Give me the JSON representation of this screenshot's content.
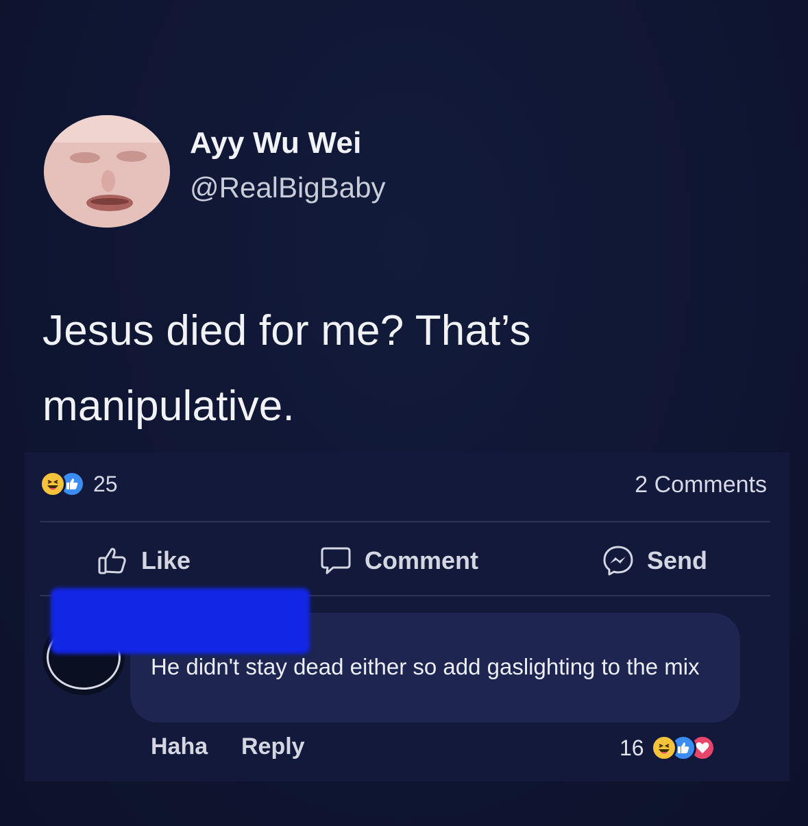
{
  "post": {
    "display_name": "Ayy Wu Wei",
    "handle": "@RealBigBaby",
    "text": "Jesus died for me? That’s manipulative."
  },
  "facebook": {
    "reactions": {
      "icons": [
        "haha-icon",
        "like-icon"
      ],
      "count": "25"
    },
    "comments_count": "2 Comments",
    "actions": {
      "like": "Like",
      "comment": "Comment",
      "send": "Send"
    },
    "comment": {
      "text": "He didn't stay dead either so add gaslighting to the mix",
      "haha_label": "Haha",
      "reply_label": "Reply",
      "reaction_count": "16",
      "reaction_icons": [
        "haha-icon",
        "like-icon",
        "love-icon"
      ]
    }
  },
  "colors": {
    "background": "#0e1530",
    "panel": "#12193a",
    "bubble": "#1d2550",
    "redaction": "#1226e6",
    "haha": "#f5c33b",
    "like": "#3b8df3",
    "love": "#e8456b"
  }
}
